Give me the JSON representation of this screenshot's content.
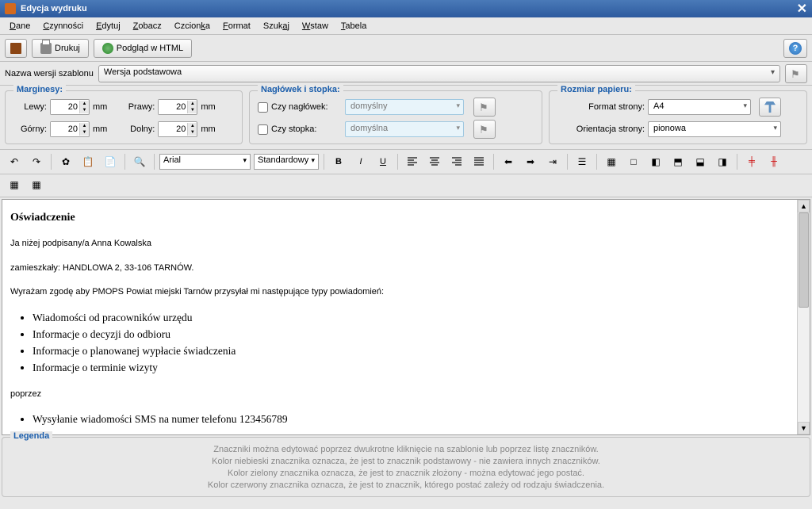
{
  "window": {
    "title": "Edycja wydruku"
  },
  "menu": {
    "dane": "Dane",
    "czynnosci": "Czynności",
    "edytuj": "Edytuj",
    "zobacz": "Zobacz",
    "czcionka": "Czcionka",
    "format": "Format",
    "szukaj": "Szukaj",
    "wstaw": "Wstaw",
    "tabela": "Tabela"
  },
  "toolbar": {
    "drukuj": "Drukuj",
    "podglad": "Podgląd w HTML"
  },
  "template": {
    "label": "Nazwa wersji szablonu",
    "value": "Wersja podstawowa"
  },
  "margins": {
    "title": "Marginesy:",
    "lewy_label": "Lewy:",
    "lewy": "20",
    "prawy_label": "Prawy:",
    "prawy": "20",
    "gorny_label": "Górny:",
    "gorny": "20",
    "dolny_label": "Dolny:",
    "dolny": "20",
    "unit": "mm"
  },
  "headerfooter": {
    "title": "Nagłówek i stopka:",
    "naglowek_label": "Czy nagłówek:",
    "naglowek_value": "domyślny",
    "stopka_label": "Czy stopka:",
    "stopka_value": "domyślna"
  },
  "paper": {
    "title": "Rozmiar papieru:",
    "format_label": "Format strony:",
    "format_value": "A4",
    "orient_label": "Orientacja strony:",
    "orient_value": "pionowa"
  },
  "editor_toolbar": {
    "font": "Arial",
    "size": "Standardowy"
  },
  "doc": {
    "h1": "Oświadczenie",
    "p1": "Ja niżej podpisany/a Anna Kowalska",
    "p2": "zamieszkały: HANDLOWA 2, 33-106 TARNÓW.",
    "p3": "Wyrażam zgodę aby PMOPS Powiat miejski Tarnów przysyłał mi następujące typy powiadomień:",
    "li1": "Wiadomości od pracowników urzędu",
    "li2": "Informacje o decyzji do odbioru",
    "li3": "Informacje o planowanej wypłacie świadczenia",
    "li4": "Informacje o terminie wizyty",
    "p4": "poprzez",
    "li5": "Wysyłanie wiadomości SMS na numer telefonu 123456789"
  },
  "legend": {
    "title": "Legenda",
    "l1": "Znaczniki można edytować poprzez dwukrotne kliknięcie na szablonie lub poprzez listę znaczników.",
    "l2": "Kolor niebieski znacznika oznacza, że jest to znacznik podstawowy - nie zawiera innych znaczników.",
    "l3": "Kolor zielony znacznika oznacza, że jest to znacznik złożony - można edytować jego postać.",
    "l4": "Kolor czerwony znacznika oznacza, że jest to znacznik, którego postać zależy od rodzaju świadczenia."
  }
}
